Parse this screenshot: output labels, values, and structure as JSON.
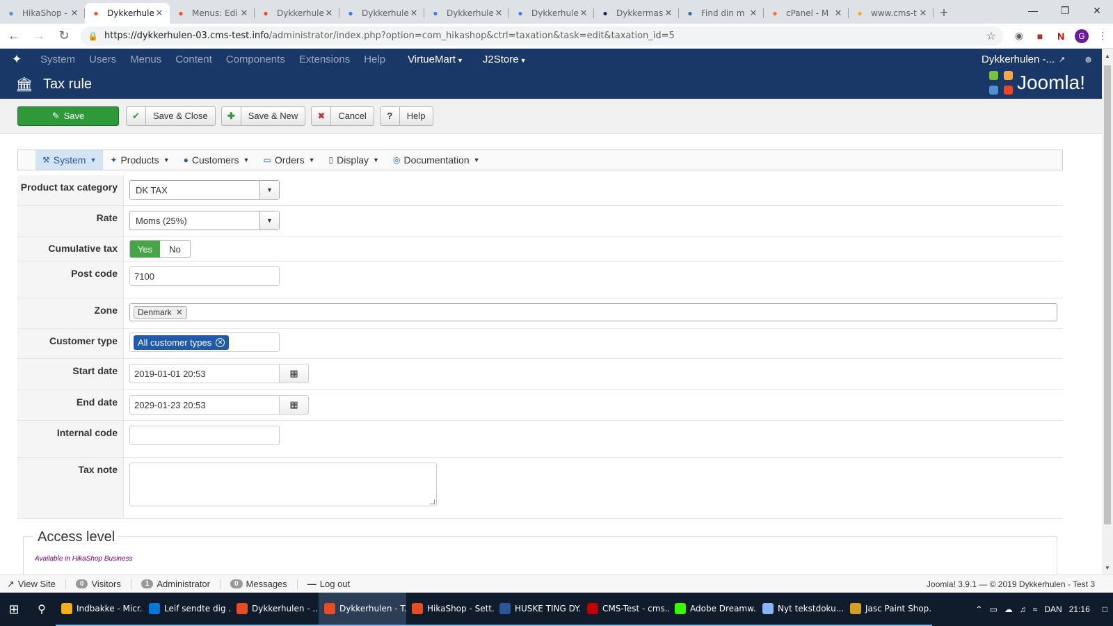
{
  "browser": {
    "tabs": [
      {
        "title": "HikaShop -",
        "icon": "hikashop-icon",
        "color": "#4a8fd6",
        "active": false
      },
      {
        "title": "Dykkerhule",
        "icon": "joomla-icon",
        "color": "#e44d26",
        "active": true
      },
      {
        "title": "Menus: Edi",
        "icon": "joomla-icon",
        "color": "#e44d26",
        "active": false
      },
      {
        "title": "Dykkerhule",
        "icon": "joomla-icon",
        "color": "#e44d26",
        "active": false
      },
      {
        "title": "Dykkerhule",
        "icon": "site-icon",
        "color": "#3b7dd8",
        "active": false
      },
      {
        "title": "Dykkerhule",
        "icon": "site-icon",
        "color": "#3b7dd8",
        "active": false
      },
      {
        "title": "Dykkerhule",
        "icon": "site-icon",
        "color": "#3b7dd8",
        "active": false
      },
      {
        "title": "Dykkermas",
        "icon": "site-icon",
        "color": "#1a2a4a",
        "active": false
      },
      {
        "title": "Find din m",
        "icon": "oa-icon",
        "color": "#2b6cb0",
        "active": false
      },
      {
        "title": "cPanel - M",
        "icon": "cpanel-icon",
        "color": "#ff6c2c",
        "active": false
      },
      {
        "title": "www.cms-t",
        "icon": "site-icon",
        "color": "#f5a623",
        "active": false
      }
    ],
    "url_host": "https://dykkerhulen-03.cms-test.info",
    "url_path": "/administrator/index.php?option=com_hikashop&ctrl=taxation&task=edit&taxation_id=5",
    "profile_initial": "G"
  },
  "joomla_nav": {
    "items": [
      "System",
      "Users",
      "Menus",
      "Content",
      "Components",
      "Extensions",
      "Help"
    ],
    "extra": [
      "VirtueMart",
      "J2Store"
    ],
    "site_name": "Dykkerhulen -...",
    "brand": "Joomla!"
  },
  "page": {
    "title": "Tax rule"
  },
  "toolbar": {
    "save": "Save",
    "save_close": "Save & Close",
    "save_new": "Save & New",
    "cancel": "Cancel",
    "help": "Help"
  },
  "hika_menu": [
    {
      "label": "System",
      "icon": "wrench-icon",
      "active": true
    },
    {
      "label": "Products",
      "icon": "cubes-icon",
      "active": false
    },
    {
      "label": "Customers",
      "icon": "user-icon",
      "active": false
    },
    {
      "label": "Orders",
      "icon": "credit-card-icon",
      "active": false
    },
    {
      "label": "Display",
      "icon": "mobile-icon",
      "active": false
    },
    {
      "label": "Documentation",
      "icon": "life-ring-icon",
      "active": false
    }
  ],
  "form": {
    "tax_category_label": "Product tax category",
    "tax_category_value": "DK TAX",
    "rate_label": "Rate",
    "rate_value": "Moms (25%)",
    "cumulative_label": "Cumulative tax",
    "cumulative_yes": "Yes",
    "cumulative_no": "No",
    "postcode_label": "Post code",
    "postcode_value": "7100",
    "zone_label": "Zone",
    "zone_value": "Denmark",
    "customer_type_label": "Customer type",
    "customer_type_value": "All customer types",
    "start_date_label": "Start date",
    "start_date_value": "2019-01-01 20:53",
    "end_date_label": "End date",
    "end_date_value": "2029-01-23 20:53",
    "internal_code_label": "Internal code",
    "internal_code_value": "",
    "tax_note_label": "Tax note"
  },
  "access": {
    "legend": "Access level",
    "note": "Available in HikaShop Business"
  },
  "statusbar": {
    "view_site": "View Site",
    "visitors_count": "0",
    "visitors": "Visitors",
    "admin_count": "1",
    "administrator": "Administrator",
    "messages_count": "0",
    "messages": "Messages",
    "logout": "Log out",
    "footer": "Joomla! 3.9.1 — © 2019 Dykkerhulen - Test 3"
  },
  "taskbar": {
    "items": [
      {
        "label": "Indbakke - Micr...",
        "color": "#f2b01e",
        "active": false
      },
      {
        "label": "Leif sendte dig ...",
        "color": "#0078d7",
        "active": false
      },
      {
        "label": "Dykkerhulen - ...",
        "color": "#e44d26",
        "active": false
      },
      {
        "label": "Dykkerhulen - T...",
        "color": "#e44d26",
        "active": true
      },
      {
        "label": "HikaShop - Sett...",
        "color": "#e44d26",
        "active": false
      },
      {
        "label": "HUSKE TING DY...",
        "color": "#2b579a",
        "active": false
      },
      {
        "label": "CMS-Test - cms...",
        "color": "#bf0000",
        "active": false
      },
      {
        "label": "Adobe Dreamw...",
        "color": "#35fa00",
        "active": false
      },
      {
        "label": "Nyt tekstdoku...",
        "color": "#8ab4f8",
        "active": false
      },
      {
        "label": "Jasc Paint Shop...",
        "color": "#d4a020",
        "active": false
      }
    ],
    "lang": "DAN",
    "time": "21:16"
  },
  "colors": {
    "joomla_blue": "#1a3867",
    "save_green": "#2f9839",
    "toggle_green": "#46a546",
    "hika_blue": "#215aa8"
  }
}
